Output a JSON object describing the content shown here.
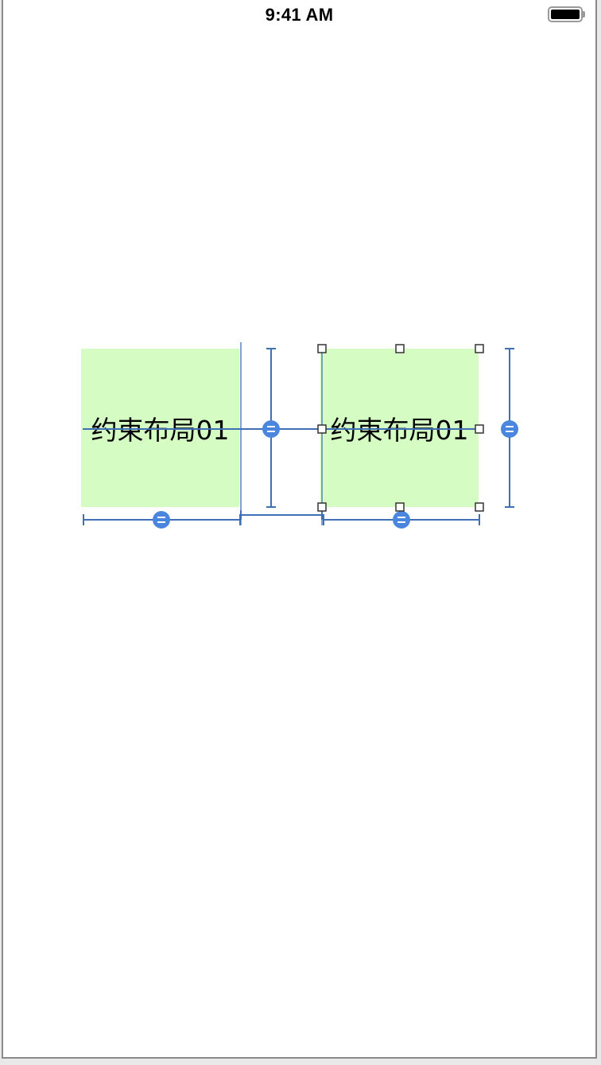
{
  "status_bar": {
    "time": "9:41 AM",
    "battery_icon": "battery-full-icon"
  },
  "views": [
    {
      "label": "约束布局01",
      "background": "#d5fcc3",
      "selected": false
    },
    {
      "label": "约束布局01",
      "background": "#d5fcc3",
      "selected": true
    }
  ],
  "constraint_color": "#3f6fb5",
  "equal_badge_color": "#4a86dd",
  "equal_badge_symbol": "="
}
